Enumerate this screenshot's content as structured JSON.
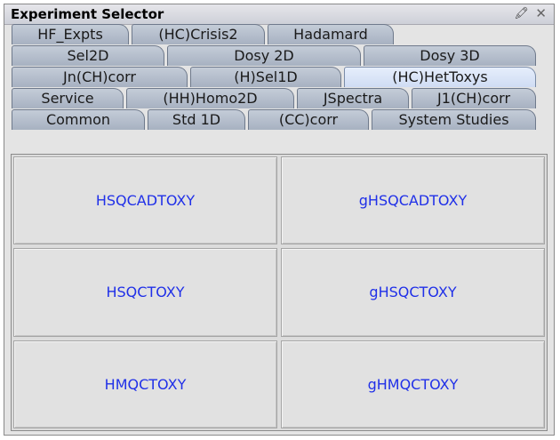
{
  "window": {
    "title": "Experiment Selector"
  },
  "tab_rows": [
    [
      {
        "label": "HF_Expts"
      },
      {
        "label": "(HC)Crisis2"
      },
      {
        "label": "Hadamard"
      }
    ],
    [
      {
        "label": "Sel2D"
      },
      {
        "label": "Dosy 2D"
      },
      {
        "label": "Dosy 3D"
      }
    ],
    [
      {
        "label": "Jn(CH)corr"
      },
      {
        "label": "(H)Sel1D"
      },
      {
        "label": "(HC)HetToxys",
        "selected": true
      }
    ],
    [
      {
        "label": "Service"
      },
      {
        "label": "(HH)Homo2D"
      },
      {
        "label": "JSpectra"
      },
      {
        "label": "J1(CH)corr"
      }
    ],
    [
      {
        "label": "Common"
      },
      {
        "label": "Std 1D"
      },
      {
        "label": "(CC)corr"
      },
      {
        "label": "System Studies"
      }
    ]
  ],
  "experiments": [
    "HSQCADTOXY",
    "gHSQCADTOXY",
    "HSQCTOXY",
    "gHSQCTOXY",
    "HMQCTOXY",
    "gHMQCTOXY"
  ],
  "colors": {
    "button_text": "#2030e8",
    "selected_tab": "#d7e3f7",
    "tab": "#b3bccb"
  }
}
